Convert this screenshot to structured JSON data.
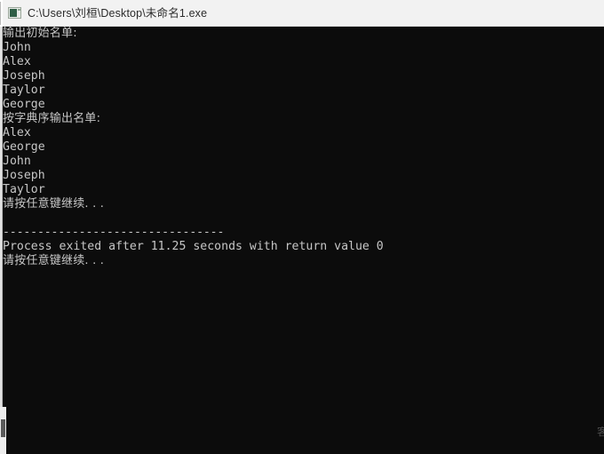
{
  "window": {
    "title": "C:\\Users\\刘桓\\Desktop\\未命名1.exe",
    "icon_name": "console-app-icon",
    "titlebar_bg": "#f2f2f2",
    "titlebar_text_color": "#2b2b2b"
  },
  "console": {
    "background": "#0c0c0c",
    "foreground": "#c6c6c6",
    "font_size_px": 13,
    "line_height_px": 16,
    "lines": [
      {
        "text": "输出初始名单:",
        "cjk": true
      },
      {
        "text": "John",
        "cjk": false
      },
      {
        "text": "Alex",
        "cjk": false
      },
      {
        "text": "Joseph",
        "cjk": false
      },
      {
        "text": "Taylor",
        "cjk": false
      },
      {
        "text": "George",
        "cjk": false
      },
      {
        "text": "按字典序输出名单:",
        "cjk": true
      },
      {
        "text": "Alex",
        "cjk": false
      },
      {
        "text": "George",
        "cjk": false
      },
      {
        "text": "John",
        "cjk": false
      },
      {
        "text": "Joseph",
        "cjk": false
      },
      {
        "text": "Taylor",
        "cjk": false
      },
      {
        "text": "请按任意键继续. . .",
        "cjk": true
      },
      {
        "text": "",
        "cjk": false
      },
      {
        "text": "--------------------------------",
        "cjk": false,
        "separator": true
      },
      {
        "text": "Process exited after 11.25 seconds with return value 0",
        "cjk": false
      },
      {
        "text": "请按任意键继续. . .",
        "cjk": true
      }
    ],
    "program_output": {
      "initial_list_header": "输出初始名单:",
      "initial_list": [
        "John",
        "Alex",
        "Joseph",
        "Taylor",
        "George"
      ],
      "sorted_list_header": "按字典序输出名单:",
      "sorted_list": [
        "Alex",
        "George",
        "John",
        "Joseph",
        "Taylor"
      ],
      "pause_prompt": "请按任意键继续. . .",
      "separator": "--------------------------------",
      "exit_message": "Process exited after 11.25 seconds with return value 0",
      "elapsed_seconds": "11.25",
      "return_value": "0"
    }
  },
  "artifacts": {
    "right_edge_ghost": "客"
  }
}
